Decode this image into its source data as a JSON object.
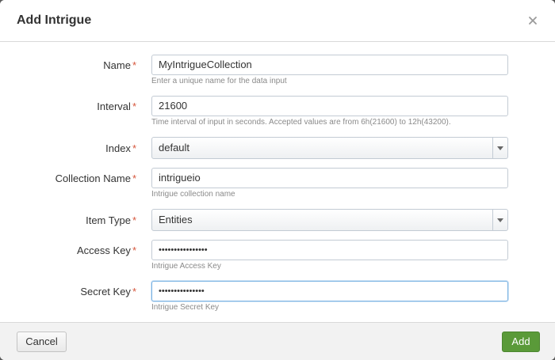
{
  "dialog": {
    "title": "Add Intrigue",
    "close_icon": "close-icon"
  },
  "form": {
    "required_marker": "*",
    "name": {
      "label": "Name",
      "value": "MyIntrigueCollection",
      "help": "Enter a unique name for the data input"
    },
    "interval": {
      "label": "Interval",
      "value": "21600",
      "help": "Time interval of input in seconds. Accepted values are from 6h(21600) to 12h(43200)."
    },
    "index": {
      "label": "Index",
      "selected": "default",
      "icon": "caret-down-icon"
    },
    "collection_name": {
      "label": "Collection Name",
      "value": "intrigueio",
      "help": "Intrigue collection name"
    },
    "item_type": {
      "label": "Item Type",
      "selected": "Entities",
      "icon": "caret-down-icon"
    },
    "access_key": {
      "label": "Access Key",
      "value": "••••••••••••••••",
      "help": "Intrigue Access Key"
    },
    "secret_key": {
      "label": "Secret Key",
      "value": "•••••••••••••••",
      "help": "Intrigue Secret Key"
    }
  },
  "footer": {
    "cancel_label": "Cancel",
    "add_label": "Add"
  },
  "colors": {
    "required": "#d6563c",
    "primary_button": "#5a9a39",
    "focus_border": "#7ab3e3"
  }
}
